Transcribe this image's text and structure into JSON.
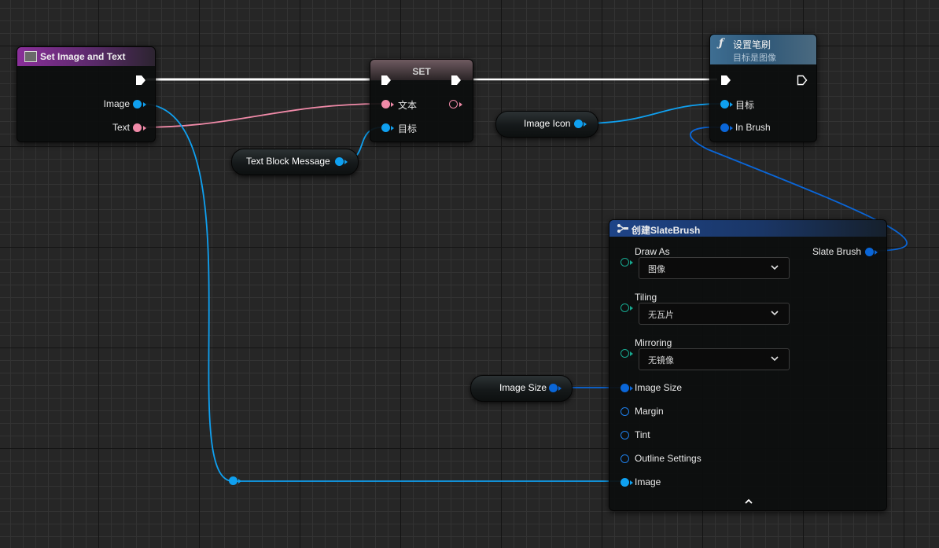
{
  "nodes": {
    "set_image_text": {
      "title": "Set Image and Text",
      "pins": {
        "image": "Image",
        "text": "Text"
      }
    },
    "set": {
      "title": "SET",
      "pins": {
        "text": "文本",
        "target": "目标"
      }
    },
    "set_brush": {
      "title": "设置笔刷",
      "subtitle": "目标是图像",
      "pins": {
        "target": "目标",
        "in_brush": "In Brush"
      }
    },
    "make_slate_brush": {
      "title": "创建SlateBrush",
      "output": "Slate Brush",
      "pins": {
        "draw_as": "Draw As",
        "draw_as_value": "图像",
        "tiling": "Tiling",
        "tiling_value": "无瓦片",
        "mirroring": "Mirroring",
        "mirroring_value": "无镜像",
        "image_size": "Image Size",
        "margin": "Margin",
        "tint": "Tint",
        "outline_settings": "Outline Settings",
        "image": "Image"
      }
    }
  },
  "variables": {
    "text_block_message": "Text Block Message",
    "image_icon": "Image Icon",
    "image_size": "Image Size"
  },
  "icons": {
    "function": "function-icon",
    "make_struct": "make-struct-icon",
    "widget": "widget-icon",
    "collapse": "collapse-chevron-icon"
  },
  "colors": {
    "exec_wire": "#ffffff",
    "object_pin": "#0fa0f0",
    "struct_pin": "#0a66d8",
    "text_pin": "#f08aa8",
    "enum_pin": "#17a890",
    "event_header": "#7a2c8a",
    "function_header": "#3a6a8c",
    "make_header": "#1c3e7a"
  }
}
